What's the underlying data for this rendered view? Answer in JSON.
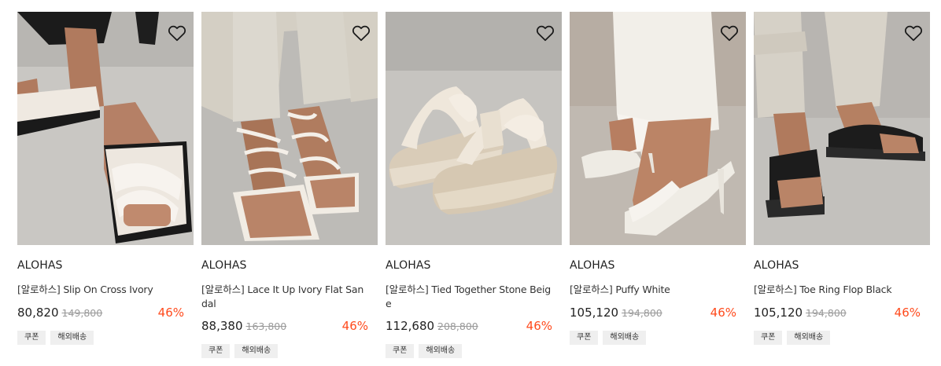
{
  "products": [
    {
      "brand": "ALOHAS",
      "title": "[알로하스] Slip On Cross Ivory",
      "price": "80,820",
      "original_price": "149,800",
      "discount": "46%",
      "tags": [
        "쿠폰",
        "해외배송"
      ]
    },
    {
      "brand": "ALOHAS",
      "title": "[알로하스] Lace It Up Ivory Flat Sandal",
      "price": "88,380",
      "original_price": "163,800",
      "discount": "46%",
      "tags": [
        "쿠폰",
        "해외배송"
      ]
    },
    {
      "brand": "ALOHAS",
      "title": "[알로하스] Tied Together Stone Beige",
      "price": "112,680",
      "original_price": "208,800",
      "discount": "46%",
      "tags": [
        "쿠폰",
        "해외배송"
      ]
    },
    {
      "brand": "ALOHAS",
      "title": "[알로하스] Puffy White",
      "price": "105,120",
      "original_price": "194,800",
      "discount": "46%",
      "tags": [
        "쿠폰",
        "해외배송"
      ]
    },
    {
      "brand": "ALOHAS",
      "title": "[알로하스] Toe Ring Flop Black",
      "price": "105,120",
      "original_price": "194,800",
      "discount": "46%",
      "tags": [
        "쿠폰",
        "해외배송"
      ]
    }
  ],
  "icons": {
    "wishlist": "heart-outline-icon"
  },
  "colors": {
    "discount": "#ff4a1c",
    "tag_bg": "#efefef"
  }
}
